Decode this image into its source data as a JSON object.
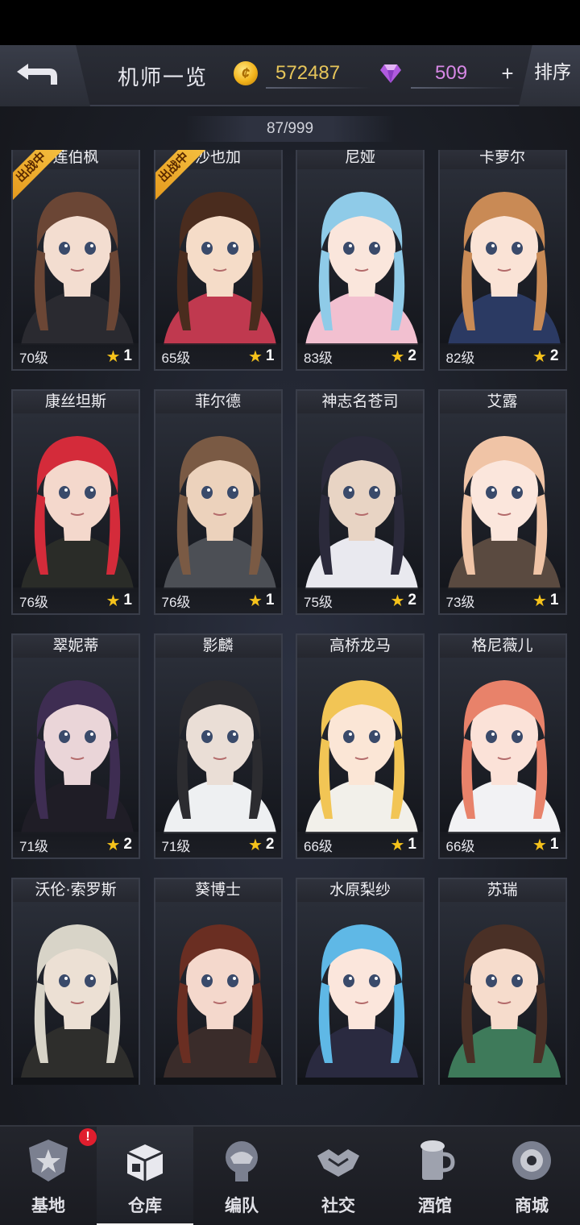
{
  "header": {
    "title": "机师一览",
    "gold": "572487",
    "gems": "509",
    "plus": "+",
    "sort_label": "排序"
  },
  "count": "87/999",
  "deployed_label": "出战中",
  "pilots": [
    {
      "name": "莲伯枫",
      "level": "70级",
      "stars": "1",
      "deployed": true,
      "hair": "#6b4635",
      "skin": "#f3ddd0",
      "outfit": "#2a2a30"
    },
    {
      "name": "沙也加",
      "level": "65级",
      "stars": "1",
      "deployed": true,
      "hair": "#4a2c1e",
      "skin": "#f5dcc8",
      "outfit": "#c0394f"
    },
    {
      "name": "尼娅",
      "level": "83级",
      "stars": "2",
      "deployed": false,
      "hair": "#8fcbe8",
      "skin": "#fae6dc",
      "outfit": "#f2c0d0"
    },
    {
      "name": "卡萝尔",
      "level": "82级",
      "stars": "2",
      "deployed": false,
      "hair": "#c98a55",
      "skin": "#fae3d6",
      "outfit": "#2b3a63"
    },
    {
      "name": "康丝坦斯",
      "level": "76级",
      "stars": "1",
      "deployed": false,
      "hair": "#d42b3a",
      "skin": "#f4d8cc",
      "outfit": "#2a2c28"
    },
    {
      "name": "菲尔德",
      "level": "76级",
      "stars": "1",
      "deployed": false,
      "hair": "#7a5a44",
      "skin": "#ecd2bc",
      "outfit": "#4c4f55"
    },
    {
      "name": "神志名苍司",
      "level": "75级",
      "stars": "2",
      "deployed": false,
      "hair": "#2b2a3b",
      "skin": "#e8d4c4",
      "outfit": "#e9e9ef"
    },
    {
      "name": "艾露",
      "level": "73级",
      "stars": "1",
      "deployed": false,
      "hair": "#f0c4a6",
      "skin": "#fbe6dc",
      "outfit": "#5a4a40"
    },
    {
      "name": "翠妮蒂",
      "level": "71级",
      "stars": "2",
      "deployed": false,
      "hair": "#3e2d52",
      "skin": "#ead5d8",
      "outfit": "#1f1d26"
    },
    {
      "name": "影麟",
      "level": "71级",
      "stars": "2",
      "deployed": false,
      "hair": "#2c2c30",
      "skin": "#eaded6",
      "outfit": "#eef0f2"
    },
    {
      "name": "高桥龙马",
      "level": "66级",
      "stars": "1",
      "deployed": false,
      "hair": "#f2c555",
      "skin": "#fbe6d6",
      "outfit": "#f2f0ea"
    },
    {
      "name": "格尼薇儿",
      "level": "66级",
      "stars": "1",
      "deployed": false,
      "hair": "#e8826a",
      "skin": "#fbe2d8",
      "outfit": "#f2f2f4"
    },
    {
      "name": "沃伦·索罗斯",
      "level": "",
      "stars": "",
      "deployed": false,
      "hair": "#d8d4c8",
      "skin": "#ece0d4",
      "outfit": "#2e2e2c"
    },
    {
      "name": "葵博士",
      "level": "",
      "stars": "",
      "deployed": false,
      "hair": "#6a2e22",
      "skin": "#f4d8cc",
      "outfit": "#3a2c2a"
    },
    {
      "name": "水原梨纱",
      "level": "",
      "stars": "",
      "deployed": false,
      "hair": "#5fb8e6",
      "skin": "#fbe6dc",
      "outfit": "#2a2a40"
    },
    {
      "name": "苏瑞",
      "level": "",
      "stars": "",
      "deployed": false,
      "hair": "#4a3026",
      "skin": "#f6dccc",
      "outfit": "#3e7a5a"
    }
  ],
  "nav": [
    {
      "label": "基地",
      "icon": "base-icon",
      "badge": "!"
    },
    {
      "label": "仓库",
      "icon": "warehouse-icon",
      "active": true
    },
    {
      "label": "编队",
      "icon": "formation-icon"
    },
    {
      "label": "社交",
      "icon": "social-icon"
    },
    {
      "label": "酒馆",
      "icon": "tavern-icon"
    },
    {
      "label": "商城",
      "icon": "shop-icon"
    }
  ]
}
